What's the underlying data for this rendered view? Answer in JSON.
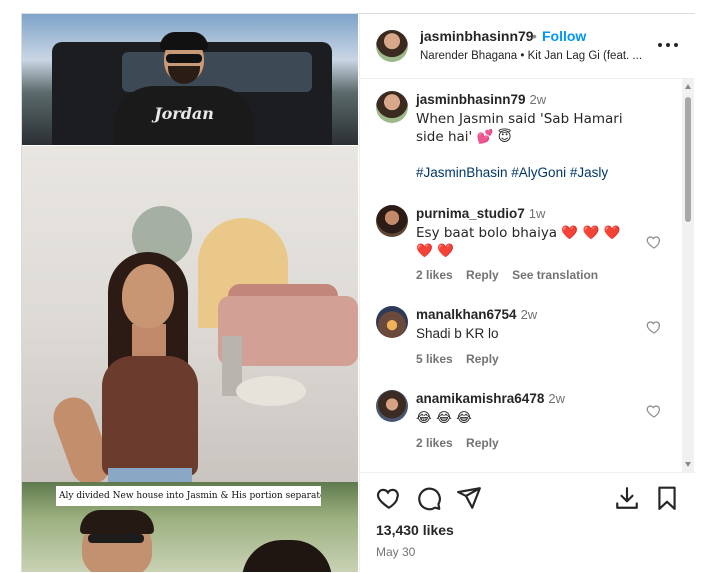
{
  "post": {
    "username": "jasminbhasinn79",
    "follow_label": "Follow",
    "separator": "•",
    "audio_line": "Narender Bhagana • Kit Jan Lag Gi (feat. ..."
  },
  "media": {
    "overlay_caption": "Aly divided New house into Jasmin & His portion separately!😏",
    "jacket_text": "Jordan"
  },
  "caption": {
    "username": "jasminbhasinn79",
    "time": "2w",
    "text": "When Jasmin said 'Sab Hamari side hai' 💕 😇",
    "hashtags": "#JasminBhasin #AlyGoni #Jasly"
  },
  "comments": [
    {
      "username": "purnima_studio7",
      "time": "1w",
      "text": "Esy baat bolo bhaiya ❤️ ❤️ ❤️ ❤️ ❤️",
      "likes": "2 likes",
      "reply": "Reply",
      "extra": "See translation"
    },
    {
      "username": "manalkhan6754",
      "time": "2w",
      "text": "Shadi b KR lo",
      "likes": "5 likes",
      "reply": "Reply",
      "extra": ""
    },
    {
      "username": "anamikamishra6478",
      "time": "2w",
      "text": "😂 😂 😂",
      "likes": "2 likes",
      "reply": "Reply",
      "extra": ""
    }
  ],
  "footer": {
    "likes": "13,430 likes",
    "date": "May 30"
  },
  "icons": {
    "like": "heart-icon",
    "comment": "comment-icon",
    "share": "share-icon",
    "download": "download-icon",
    "save": "bookmark-icon",
    "more": "more-icon"
  },
  "colors": {
    "accent": "#0095f6",
    "hashtag": "#00376b",
    "heart": "#e0245e"
  }
}
